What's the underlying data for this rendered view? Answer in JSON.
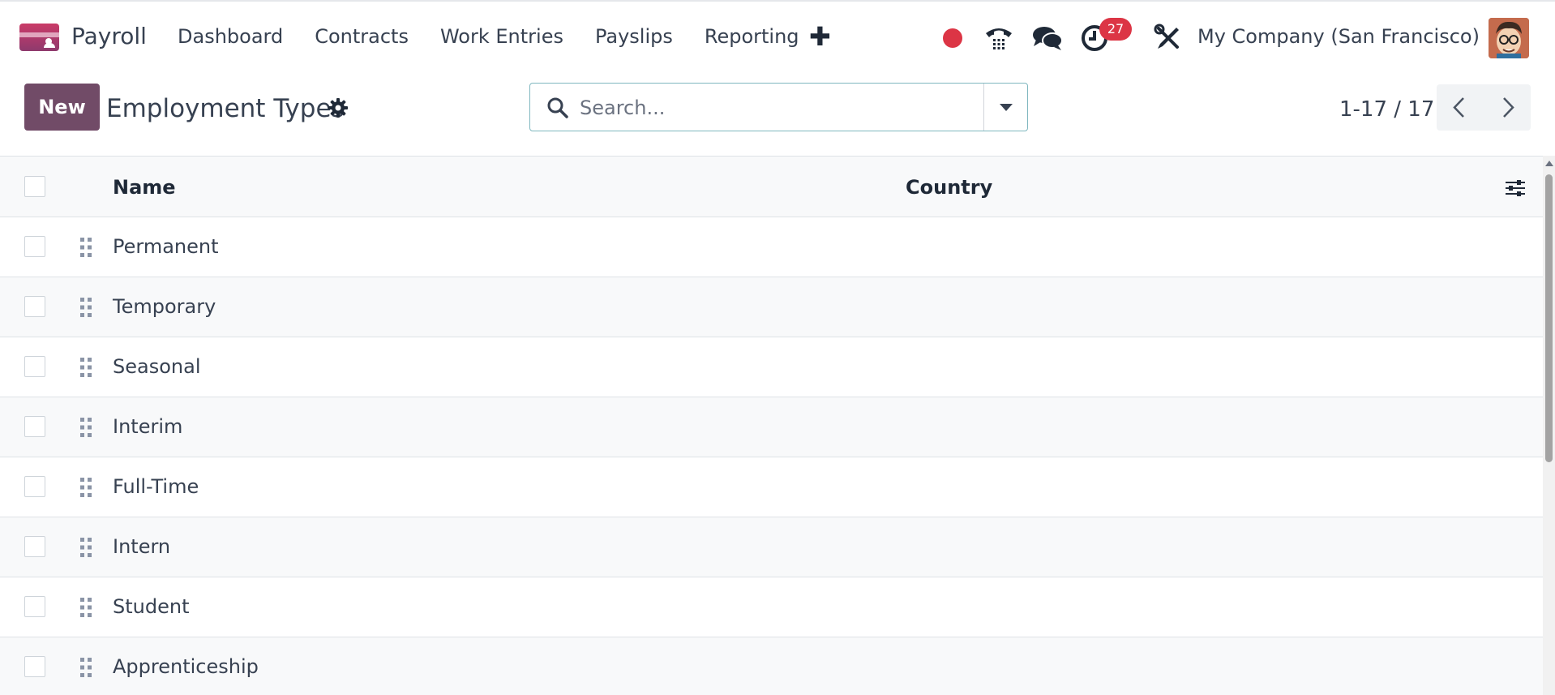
{
  "navbar": {
    "app_name": "Payroll",
    "menu": [
      "Dashboard",
      "Contracts",
      "Work Entries",
      "Payslips",
      "Reporting"
    ],
    "activity_count": "27",
    "company": "My Company (San Francisco)",
    "icons": [
      "app-logo",
      "plus-icon",
      "record-dot-icon",
      "phone-icon",
      "chat-icon",
      "clock-icon",
      "tools-icon",
      "avatar"
    ]
  },
  "control_panel": {
    "new_label": "New",
    "title": "Employment Types",
    "search_placeholder": "Search...",
    "pager": "1-17 / 17"
  },
  "table": {
    "columns": [
      "Name",
      "Country"
    ],
    "rows": [
      {
        "name": "Permanent",
        "country": ""
      },
      {
        "name": "Temporary",
        "country": ""
      },
      {
        "name": "Seasonal",
        "country": ""
      },
      {
        "name": "Interim",
        "country": ""
      },
      {
        "name": "Full-Time",
        "country": ""
      },
      {
        "name": "Intern",
        "country": ""
      },
      {
        "name": "Student",
        "country": ""
      },
      {
        "name": "Apprenticeship",
        "country": ""
      }
    ]
  },
  "colors": {
    "primary": "#714b67",
    "badge": "#dc3545",
    "record": "#dc3545",
    "search_border": "#7fb7bf"
  }
}
